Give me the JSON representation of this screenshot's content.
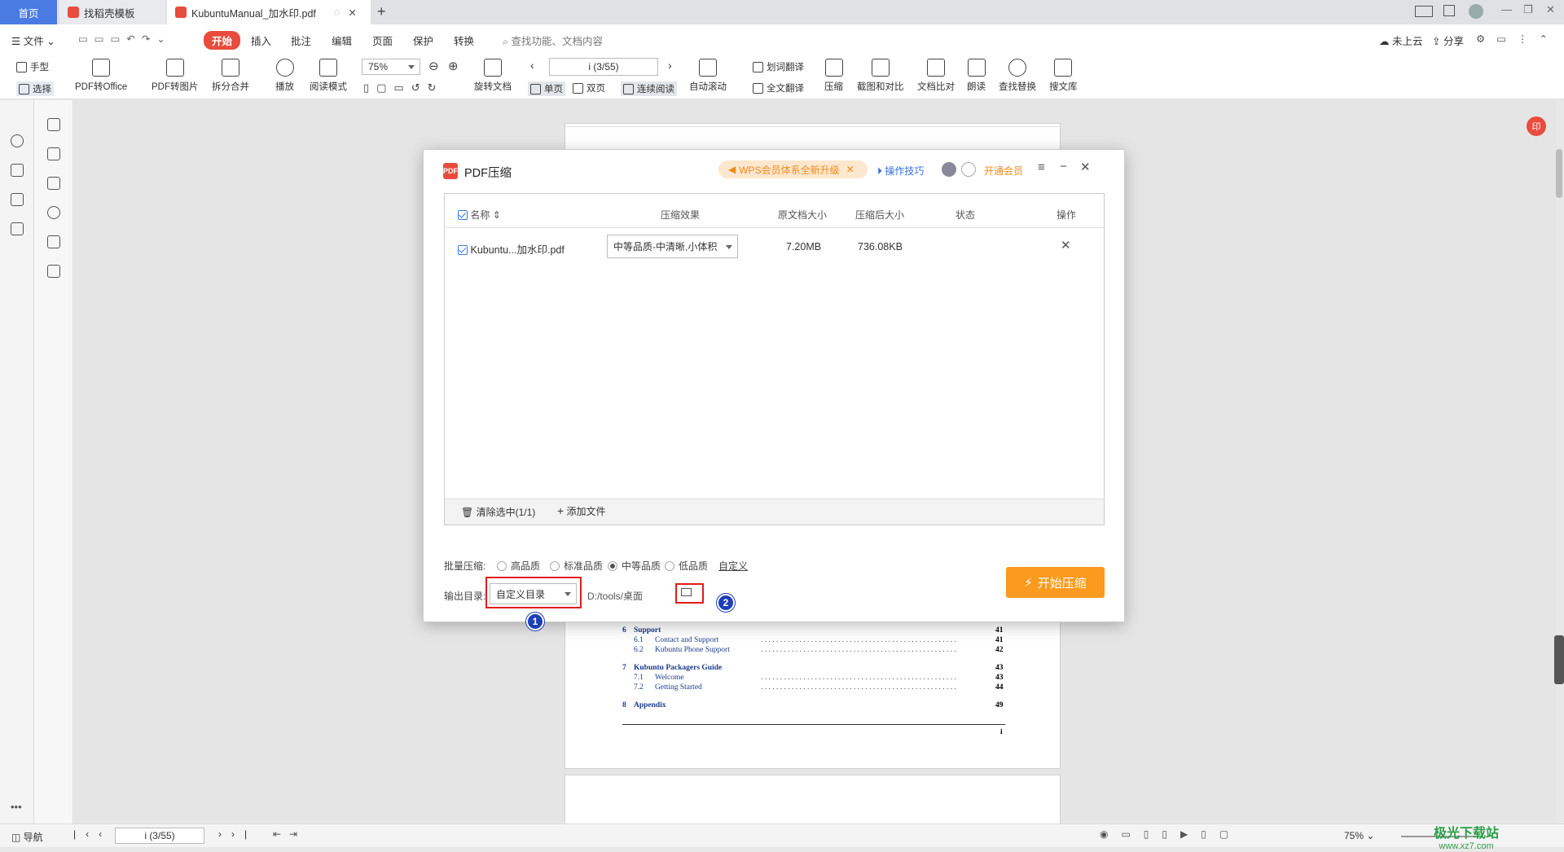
{
  "tabs": {
    "home": "首页",
    "template": "找稻壳模板",
    "doc": "KubuntuManual_加水印.pdf",
    "add": "+"
  },
  "menu": {
    "file": "文件",
    "items": [
      "开始",
      "插入",
      "批注",
      "编辑",
      "页面",
      "保护",
      "转换"
    ],
    "search_placeholder": "查找功能、文档内容",
    "cloud": "未上云",
    "share": "分享"
  },
  "toolbar": {
    "hand": "手型",
    "select": "选择",
    "pdf_to_office": "PDF转Office",
    "pdf_to_image": "PDF转图片",
    "split_merge": "拆分合并",
    "play": "播放",
    "read_mode": "阅读模式",
    "zoom": "75%",
    "rotate": "旋转文档",
    "page_indicator": "i (3/55)",
    "single_page": "单页",
    "double_page": "双页",
    "continuous": "连续阅读",
    "auto_scroll": "自动滚动",
    "word_translate": "划词翻译",
    "full_translate": "全文翻译",
    "compress": "压缩",
    "screenshot_compare": "截图和对比",
    "doc_compare": "文档比对",
    "read_aloud": "朗读",
    "find_replace": "查找替换",
    "search_lib": "搜文库"
  },
  "dialog": {
    "title": "PDF压缩",
    "logo": "PDF",
    "promo": "WPS会员体系全新升级",
    "tips": "操作技巧",
    "vip": "开通会员",
    "headers": {
      "name": "名称",
      "effect": "压缩效果",
      "orig": "原文档大小",
      "after": "压缩后大小",
      "status": "状态",
      "op": "操作"
    },
    "row": {
      "name": "Kubuntu...加水印.pdf",
      "effect": "中等品质-中清晰,小体积",
      "orig": "7.20MB",
      "after": "736.08KB"
    },
    "clear": "清除选中(1/1)",
    "add_file": "添加文件",
    "batch_label": "批量压缩:",
    "options": [
      "高品质",
      "标准品质",
      "中等品质",
      "低品质"
    ],
    "custom": "自定义",
    "output_label": "输出目录:",
    "output_select": "自定义目录",
    "output_path": "D:/tools/桌面",
    "start": "开始压缩",
    "badge1": "1",
    "badge2": "2"
  },
  "toc": [
    {
      "num": "6",
      "title": "Support",
      "page": "41",
      "bold": true
    },
    {
      "num": "6.1",
      "title": "Contact and Support",
      "page": "41",
      "bold": false
    },
    {
      "num": "6.2",
      "title": "Kubuntu Phone Support",
      "page": "42",
      "bold": false
    },
    {
      "num": "7",
      "title": "Kubuntu Packagers Guide",
      "page": "43",
      "bold": true
    },
    {
      "num": "7.1",
      "title": "Welcome",
      "page": "43",
      "bold": false
    },
    {
      "num": "7.2",
      "title": "Getting Started",
      "page": "44",
      "bold": false
    },
    {
      "num": "8",
      "title": "Appendix",
      "page": "49",
      "bold": true
    }
  ],
  "page_footer": "i",
  "status": {
    "nav": "导航",
    "page": "i (3/55)",
    "zoom": "75%"
  },
  "watermark": "极光下载站",
  "watermark_url": "www.xz7.com"
}
